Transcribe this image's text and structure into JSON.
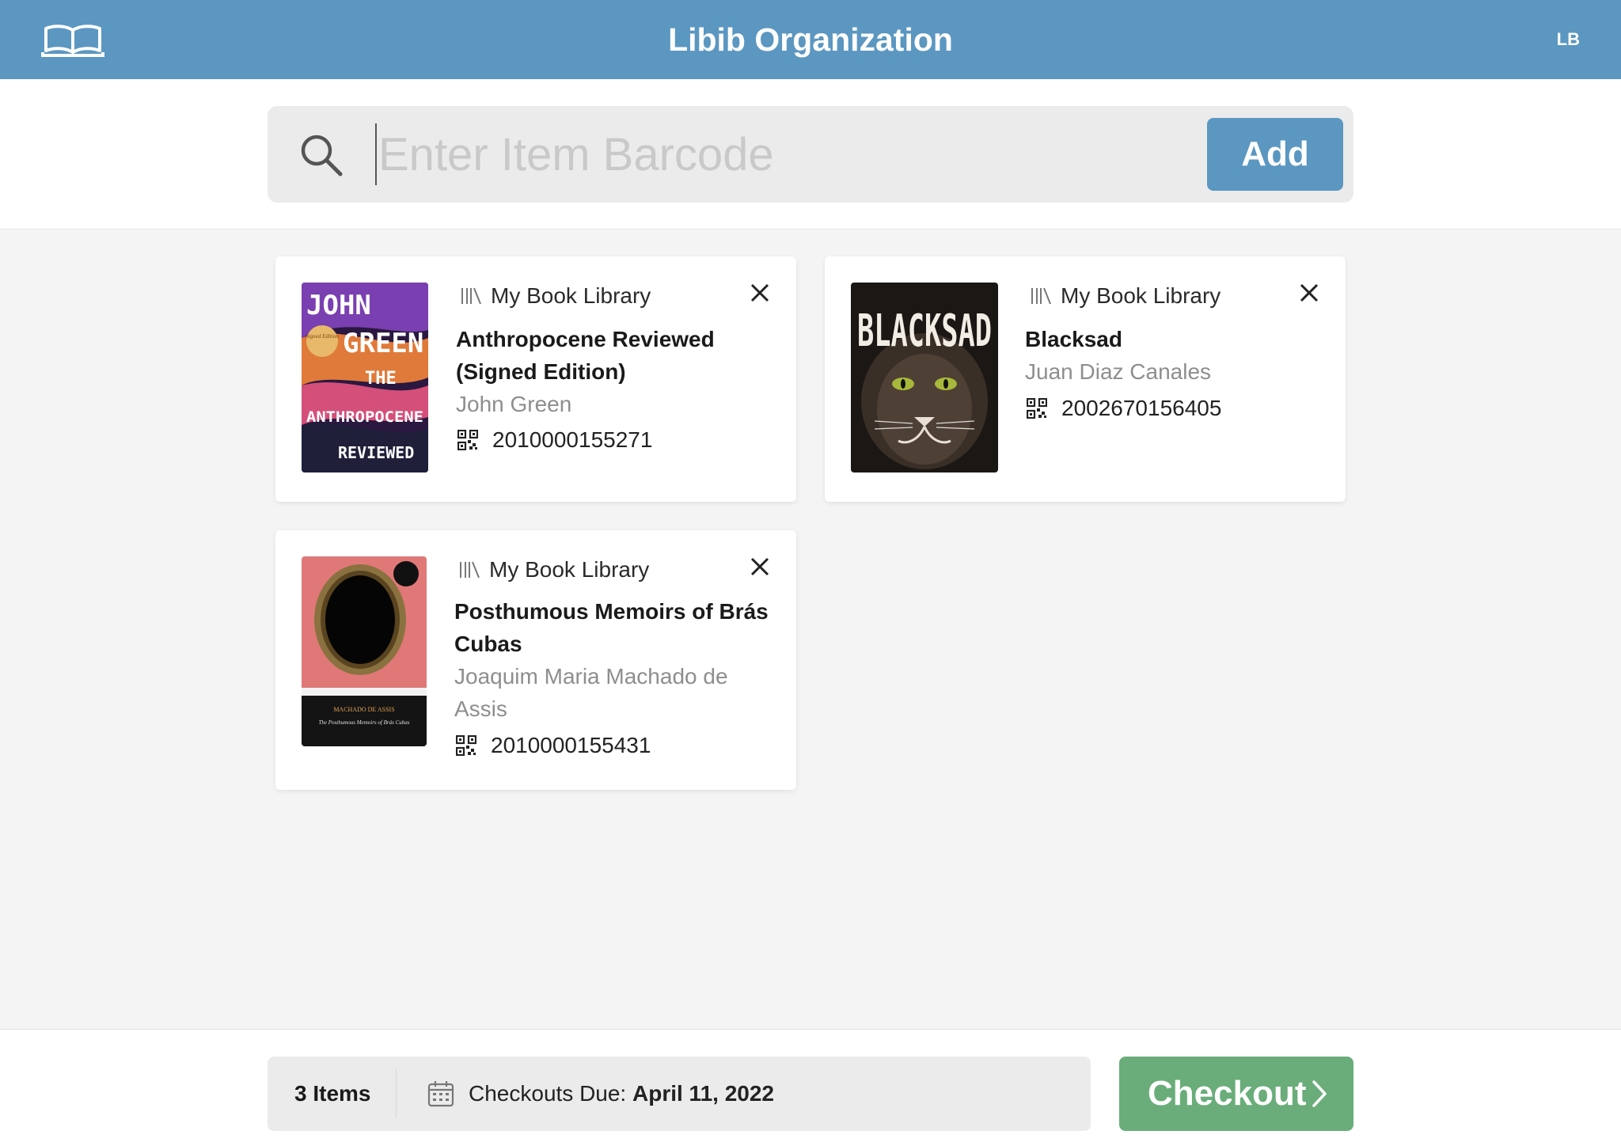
{
  "header": {
    "title": "Libib Organization",
    "user_initials": "LB"
  },
  "search": {
    "placeholder": "Enter Item Barcode",
    "value": "",
    "add_label": "Add"
  },
  "items": [
    {
      "library": "My Book Library",
      "title_lines": [
        "Anthropocene Reviewed",
        "(Signed Edition)"
      ],
      "author_lines": [
        "John Green"
      ],
      "barcode": "2010000155271",
      "cover": {
        "words": [
          "JOHN",
          "GREEN",
          "THE",
          "ANTHROPOCENE",
          "REVIEWED"
        ],
        "badge": "Signed Edition"
      }
    },
    {
      "library": "My Book Library",
      "title_lines": [
        "Blacksad"
      ],
      "author_lines": [
        "Juan Diaz Canales"
      ],
      "barcode": "2002670156405",
      "cover": {
        "words": [
          "BLACKSAD"
        ]
      }
    },
    {
      "library": "My Book Library",
      "title_lines": [
        "Posthumous Memoirs of Brás",
        "Cubas"
      ],
      "author_lines": [
        "Joaquim Maria Machado de",
        "Assis"
      ],
      "barcode": "2010000155431",
      "cover": {
        "words": [
          "MACHADO DE ASSIS",
          "The Posthumous Memoirs of Brás Cubas"
        ]
      }
    }
  ],
  "footer": {
    "item_count": "3 Items",
    "due_label": "Checkouts Due:",
    "due_date": "April 11, 2022",
    "checkout_label": "Checkout"
  },
  "colors": {
    "brand": "#5b97c1",
    "checkout": "#6aad7a"
  }
}
